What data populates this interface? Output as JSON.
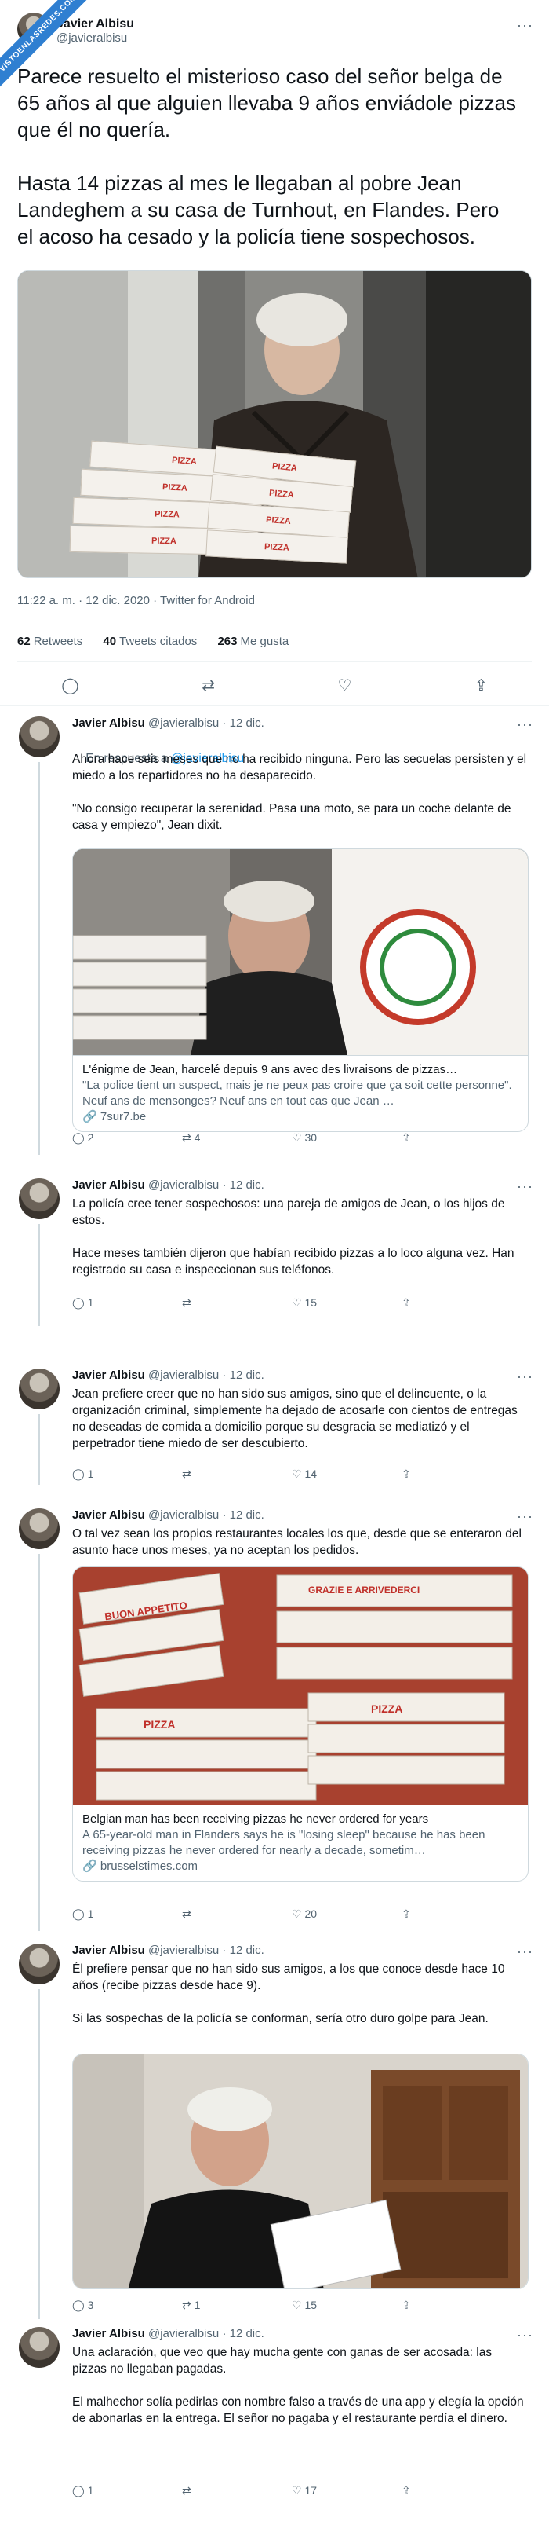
{
  "ribbon": "VISTOENLASREDES.COM",
  "main": {
    "name": "Javier Albisu",
    "handle": "@javieralbisu",
    "text": "Parece resuelto el misterioso caso del señor belga de 65 años al que alguien llevaba 9 años enviádole pizzas que él no quería.\n\nHasta 14 pizzas al mes le llegaban al pobre Jean Landeghem a su casa de Turnhout, en Flandes. Pero el acoso ha cesado y la policía tiene sospechosos.",
    "meta": "11:22 a. m. · 12 dic. 2020 · Twitter for Android",
    "retweets_count": "62",
    "retweets_label": "Retweets",
    "quotes_count": "40",
    "quotes_label": "Tweets citados",
    "likes_count": "263",
    "likes_label": "Me gusta",
    "pizza_label": "PIZZA"
  },
  "replies": [
    {
      "name": "Javier Albisu",
      "handle": "@javieralbisu",
      "date": "· 12 dic.",
      "reply_to_prefix": "En respuesta a",
      "reply_to_handle": "@javieralbisu",
      "text": "Ahora hace seis meses que no ha recibido ninguna. Pero las secuelas persisten y el miedo a los repartidores no ha desaparecido.\n\n\"No consigo recuperar la serenidad. Pasa una moto, se para un coche delante de casa y empiezo\", Jean dixit.",
      "card": {
        "title": "L'énigme de Jean, harcelé depuis 9 ans avec des livraisons de pizzas…",
        "description": "\"La police tient un suspect, mais je ne peux pas croire que ça soit cette personne\". Neuf ans de mensonges? Neuf ans en tout cas que Jean …",
        "domain": "7sur7.be"
      },
      "counts": {
        "reply": "2",
        "retweet": "4",
        "like": "30"
      }
    },
    {
      "name": "Javier Albisu",
      "handle": "@javieralbisu",
      "date": "· 12 dic.",
      "text": "La policía cree tener sospechosos: una pareja de amigos de Jean, o los hijos de estos.\n\nHace meses también dijeron que habían recibido pizzas a lo loco alguna vez. Han registrado su casa e inspeccionan sus teléfonos.",
      "counts": {
        "reply": "1",
        "retweet": "",
        "like": "15"
      }
    },
    {
      "name": "Javier Albisu",
      "handle": "@javieralbisu",
      "date": "· 12 dic.",
      "text": "Jean prefiere creer que no han sido sus amigos, sino que el delincuente, o la organización criminal, simplemente ha dejado de acosarle con cientos de entregas no deseadas de comida a domicilio porque su desgracia se mediatizó y el perpetrador tiene miedo de ser descubierto.",
      "counts": {
        "reply": "1",
        "retweet": "",
        "like": "14"
      }
    },
    {
      "name": "Javier Albisu",
      "handle": "@javieralbisu",
      "date": "· 12 dic.",
      "text": "O tal vez sean los propios restaurantes locales los que, desde que se enteraron del asunto hace unos meses, ya no aceptan los pedidos.",
      "card": {
        "title": "Belgian man has been receiving pizzas he never ordered for years",
        "description": "A 65-year-old man in Flanders says he is \"losing sleep\" because he has been receiving pizzas he never ordered for nearly a decade, sometim…",
        "domain": "brusselstimes.com",
        "box_a": "BUON APPETITO",
        "box_b": "GRAZIE E ARRIVEDERCI"
      },
      "counts": {
        "reply": "1",
        "retweet": "",
        "like": "20"
      }
    },
    {
      "name": "Javier Albisu",
      "handle": "@javieralbisu",
      "date": "· 12 dic.",
      "text": "Él prefiere pensar que no han sido sus amigos, a los que conoce desde hace 10 años (recibe pizzas desde hace 9).\n\nSi las sospechas de la policía se conforman, sería otro duro golpe para Jean.",
      "counts": {
        "reply": "3",
        "retweet": "1",
        "like": "15"
      }
    },
    {
      "name": "Javier Albisu",
      "handle": "@javieralbisu",
      "date": "· 12 dic.",
      "text": "Una aclaración, que veo que hay mucha gente con ganas de ser acosada: las pizzas no llegaban pagadas.\n\nEl malhechor solía pedirlas con nombre falso a través de una app y elegía la opción de abonarlas en la entrega. El señor no pagaba y el restaurante perdía el dinero.",
      "counts": {
        "reply": "1",
        "retweet": "",
        "like": "17"
      }
    }
  ],
  "icons": {
    "more": "···",
    "reply": "◯",
    "retweet": "⇄",
    "like": "♡",
    "share": "⇪",
    "link": "🔗"
  }
}
